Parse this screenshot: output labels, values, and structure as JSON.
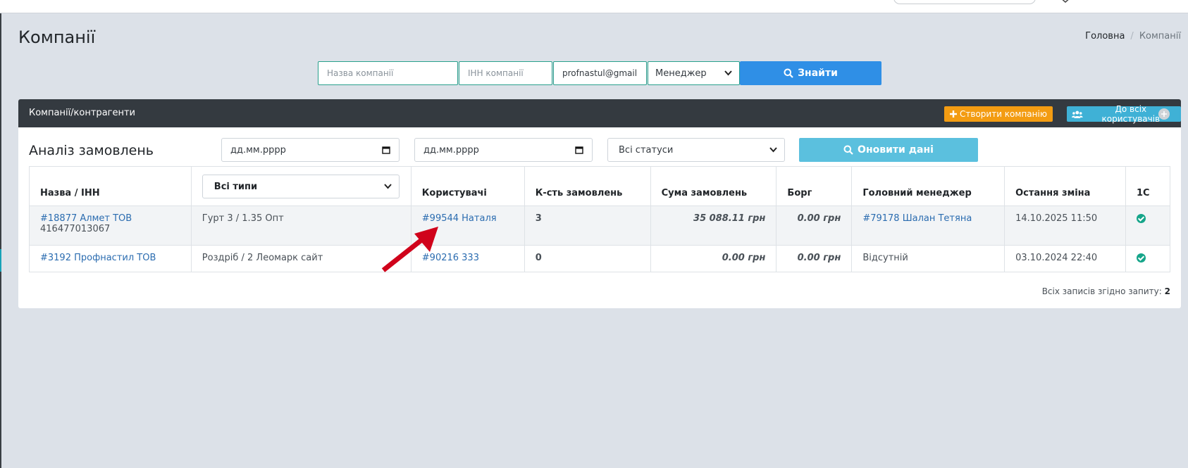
{
  "header": {
    "title": "Компанії",
    "breadcrumb": {
      "home": "Головна",
      "current": "Компанії"
    }
  },
  "filters": {
    "company_name_placeholder": "Назва компанії",
    "inn_placeholder": "ІНН компанії",
    "email_value": "profnastul@gmail.c",
    "manager_select": "Менеджер",
    "find_label": "Знайти"
  },
  "card": {
    "title": "Компанії/контрагенти",
    "create_label": "Створити компанію",
    "all_users_label": "До всіх користувачів"
  },
  "analysis": {
    "title": "Аналіз замовлень",
    "date_from_placeholder": "дд.мм.рррр",
    "date_to_placeholder": "дд.мм.рррр",
    "status_select": "Всі статуси",
    "refresh_label": "Оновити дані"
  },
  "table": {
    "columns": {
      "name": "Назва / ІНН",
      "type_select": "Всі типи",
      "users": "Користувачі",
      "orders_count": "К-сть замовлень",
      "orders_sum": "Сума замовлень",
      "debt": "Борг",
      "manager": "Головний менеджер",
      "last_change": "Остання зміна",
      "onec": "1С"
    },
    "rows": [
      {
        "name": "#18877 Алмет ТОВ",
        "inn": "416477013067",
        "type": "Гурт 3 / 1.35 Опт",
        "user": "#99544 Наталя",
        "orders_count": "3",
        "orders_sum": "35 088.11 грн",
        "debt": "0.00 грн",
        "manager": "#79178 Шалан Тетяна",
        "last_change": "14.10.2025 11:50"
      },
      {
        "name": "#3192 Профнастил ТОВ",
        "inn": "",
        "type": "Роздріб / 2 Леомарк сайт",
        "user": "#90216 333",
        "orders_count": "0",
        "orders_sum": "0.00 грн",
        "debt": "0.00 грн",
        "manager": "Відсутній",
        "last_change": "03.10.2024 22:40"
      }
    ]
  },
  "footer": {
    "total_label": "Всіх записів згідно запиту:",
    "total_value": "2"
  },
  "colors": {
    "accent_blue": "#2f8fe6",
    "accent_orange": "#f39c12",
    "accent_cyan": "#5bc0de",
    "check_green": "#16a58a",
    "annotation_red": "#d0021b"
  }
}
